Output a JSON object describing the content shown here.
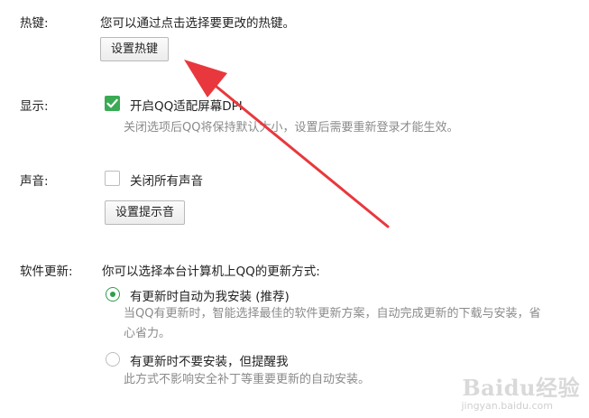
{
  "hotkey": {
    "label": "热键:",
    "description": "您可以通过点击选择要更改的热键。",
    "button": "设置热键"
  },
  "display": {
    "label": "显示:",
    "checkbox_label": "开启QQ适配屏幕DPI",
    "checked": true,
    "hint": "关闭选项后QQ将保持默认大小，设置后需要重新登录才能生效。"
  },
  "sound": {
    "label": "声音:",
    "checkbox_label": "关闭所有声音",
    "checked": false,
    "button": "设置提示音"
  },
  "update": {
    "label": "软件更新:",
    "description": "你可以选择本台计算机上QQ的更新方式:",
    "options": [
      {
        "label": "有更新时自动为我安装 (推荐)",
        "selected": true,
        "hint": "当QQ有更新时，智能选择最佳的软件更新方案，自动完成更新的下载与安装，省心省力。"
      },
      {
        "label": "有更新时不要安装，但提醒我",
        "selected": false,
        "hint": "此方式不影响安全补丁等重要更新的自动安装。"
      }
    ]
  },
  "watermark": {
    "brand": "Baidu经验",
    "url": "jingyan.baidu.com"
  },
  "colors": {
    "accent_green": "#3aaa55",
    "annotation_arrow": "#e8383d",
    "hint_gray": "#8a8a8a"
  },
  "icons": {
    "checkbox_checked": "check-icon",
    "annotation": "red-arrow-icon"
  }
}
